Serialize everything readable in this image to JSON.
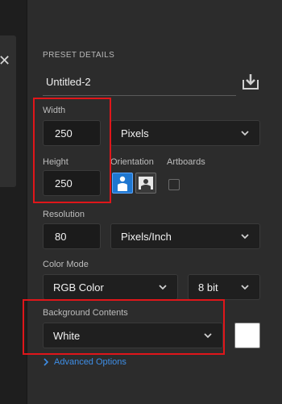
{
  "panel": {
    "section_title": "PRESET DETAILS",
    "preset_name": "Untitled-2"
  },
  "width": {
    "label": "Width",
    "value": "250",
    "unit": "Pixels"
  },
  "height": {
    "label": "Height",
    "value": "250"
  },
  "orientation": {
    "label": "Orientation",
    "selected": "portrait"
  },
  "artboards": {
    "label": "Artboards",
    "checked": false
  },
  "resolution": {
    "label": "Resolution",
    "value": "80",
    "unit": "Pixels/Inch"
  },
  "color_mode": {
    "label": "Color Mode",
    "mode": "RGB Color",
    "depth": "8 bit"
  },
  "background": {
    "label": "Background Contents",
    "value": "White",
    "swatch_color": "#ffffff"
  },
  "advanced": {
    "label": "Advanced Options"
  },
  "colors": {
    "highlight": "#e0161a",
    "accent": "#1f77d0",
    "link": "#3e8ee6"
  },
  "icons": {
    "save": "save-preset-icon",
    "close": "close-icon"
  }
}
